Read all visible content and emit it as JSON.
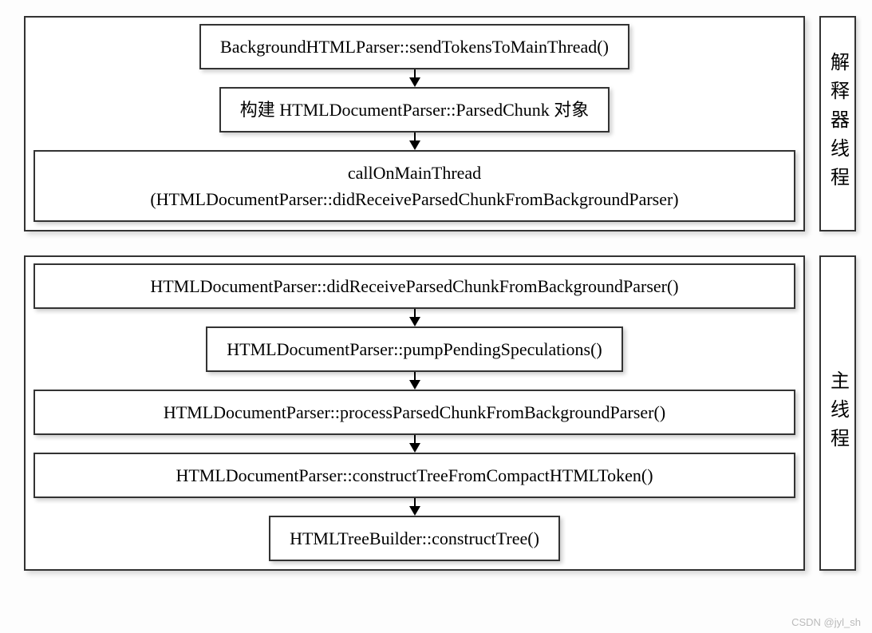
{
  "groups": [
    {
      "label": "解释器线程",
      "boxes": [
        {
          "text": "BackgroundHTMLParser::sendTokensToMainThread()",
          "full": false
        },
        {
          "text": "构建 HTMLDocumentParser::ParsedChunk 对象",
          "full": false
        },
        {
          "text": "callOnMainThread\n(HTMLDocumentParser::didReceiveParsedChunkFromBackgroundParser)",
          "full": true
        }
      ]
    },
    {
      "label": "主线程",
      "boxes": [
        {
          "text": "HTMLDocumentParser::didReceiveParsedChunkFromBackgroundParser()",
          "full": true
        },
        {
          "text": "HTMLDocumentParser::pumpPendingSpeculations()",
          "full": false
        },
        {
          "text": "HTMLDocumentParser::processParsedChunkFromBackgroundParser()",
          "full": true
        },
        {
          "text": "HTMLDocumentParser::constructTreeFromCompactHTMLToken()",
          "full": true
        },
        {
          "text": "HTMLTreeBuilder::constructTree()",
          "full": false
        }
      ]
    }
  ],
  "watermark": "CSDN @jyl_sh"
}
